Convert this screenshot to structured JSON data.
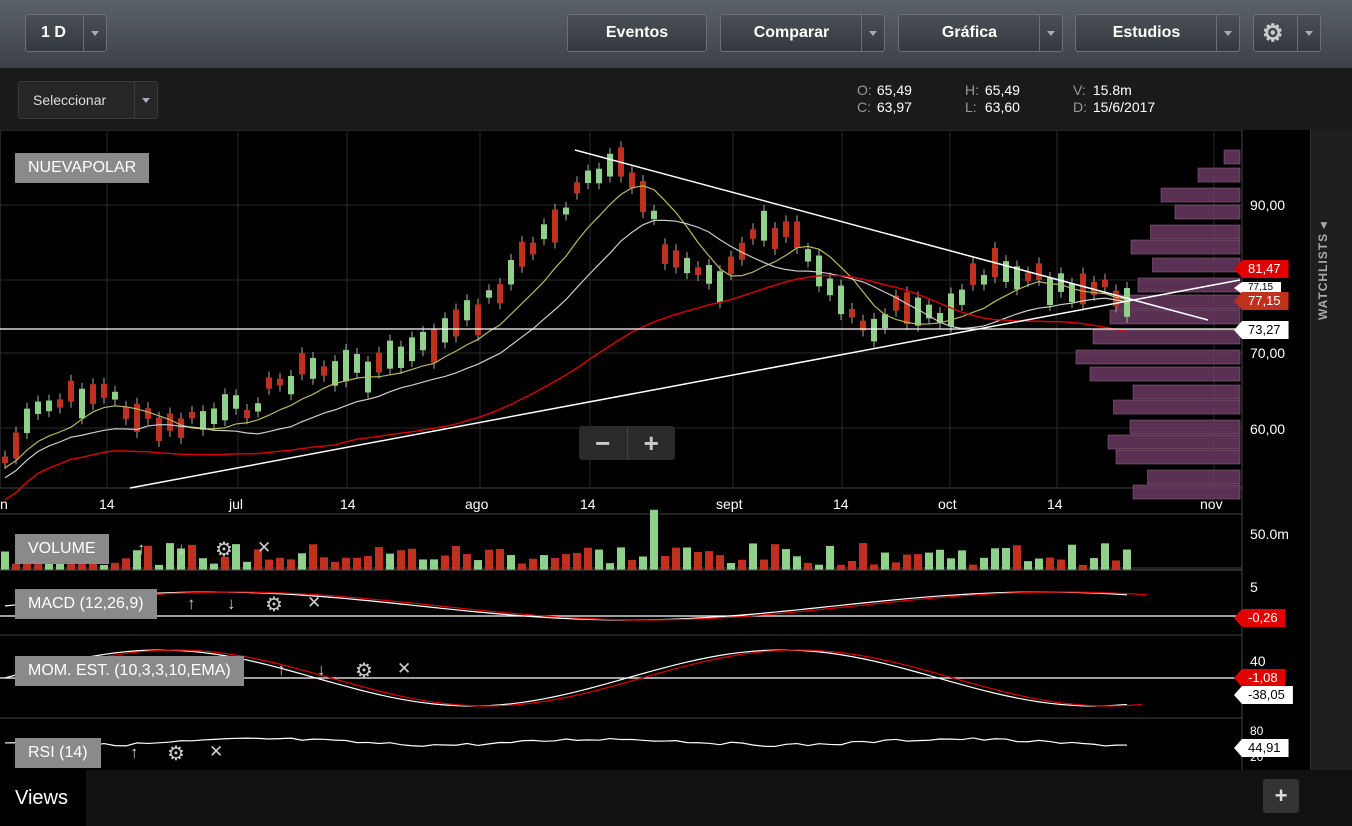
{
  "toolbar": {
    "period": "1 D",
    "events": "Eventos",
    "compare": "Comparar",
    "chart": "Gráfica",
    "studies": "Estudios"
  },
  "selector": {
    "label": "Seleccionar"
  },
  "quote": {
    "o_key": "O:",
    "o": "65,49",
    "c_key": "C:",
    "c": "63,97",
    "h_key": "H:",
    "h": "65,49",
    "l_key": "L:",
    "l": "63,60",
    "v_key": "V:",
    "v": "15.8m",
    "d_key": "D:",
    "d": "15/6/2017"
  },
  "symbol": "NUEVAPOLAR",
  "price_axis": [
    "90,00",
    "70,00",
    "60,00"
  ],
  "price_tags": {
    "red_top": "81,47",
    "white_mid": "77,15",
    "red_mid": "77,15",
    "line": "73,27"
  },
  "x_axis": [
    "n",
    "14",
    "jul",
    "14",
    "ago",
    "14",
    "sept",
    "14",
    "oct",
    "14",
    "nov"
  ],
  "indicators": {
    "volume": {
      "label": "VOLUME",
      "axis": "50.0m"
    },
    "macd": {
      "label": "MACD (12,26,9)",
      "axis": "5",
      "tag": "-0,26"
    },
    "mom": {
      "label": "MOM. EST. (10,3,3,10,EMA)",
      "axis": "40",
      "tag_red": "-1,08",
      "tag_white": "-38,05"
    },
    "rsi": {
      "label": "RSI (14)",
      "axis_top": "80",
      "axis_bottom": "20",
      "tag": "44,91"
    }
  },
  "sidebar": {
    "watchlists": "WATCHLISTS"
  },
  "footer": {
    "views": "Views",
    "add": "+"
  },
  "colors": {
    "up": "#8fd18a",
    "down": "#c0301e",
    "accent_red": "#e00000",
    "volume_profile": "#6a3a62"
  }
}
